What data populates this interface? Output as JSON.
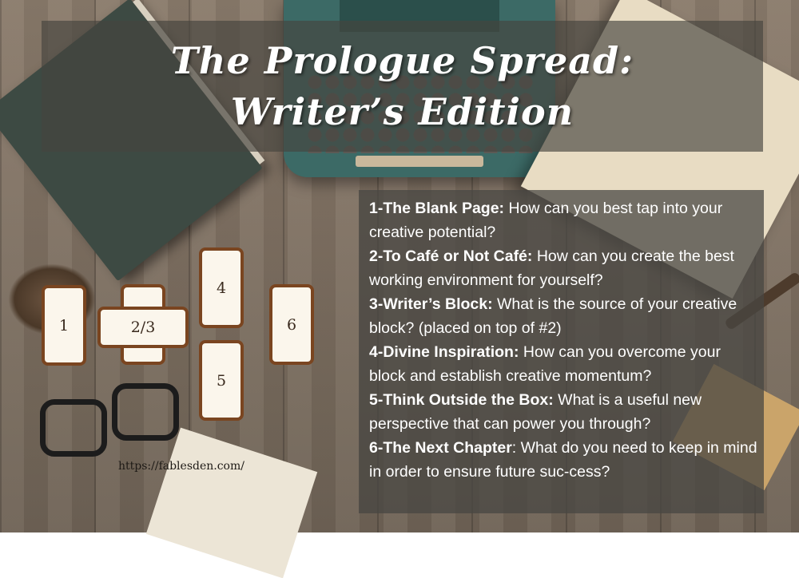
{
  "title": {
    "line1": "The Prologue Spread:",
    "line2": "Writer’s Edition"
  },
  "cards": {
    "c1": "1",
    "c23": "2/3",
    "c4": "4",
    "c5": "5",
    "c6": "6"
  },
  "entries": [
    {
      "label": "1-The Blank Page:",
      "text": " How can you best tap into your creative potential?"
    },
    {
      "label": "2-To Café or Not Café:",
      "text": " How can you create the best working environment for yourself?"
    },
    {
      "label": "3-Writer’s Block:",
      "text": " What is the source of your creative block? (placed on top of #2)"
    },
    {
      "label": "4-Divine Inspiration:",
      "text": " How can you  overcome your block and establish creative momentum?"
    },
    {
      "label": "5-Think Outside the Box:",
      "text": " What is a useful new perspective that can power you through?"
    },
    {
      "label": "6-The Next Chapter",
      "text": ": What do you need to keep in mind in order to ensure future suc-cess?"
    }
  ],
  "url": "https://fablesden.com/",
  "colors": {
    "card_border": "#7a4520",
    "card_fill": "#fbf6ec",
    "panel": "#48463f"
  }
}
